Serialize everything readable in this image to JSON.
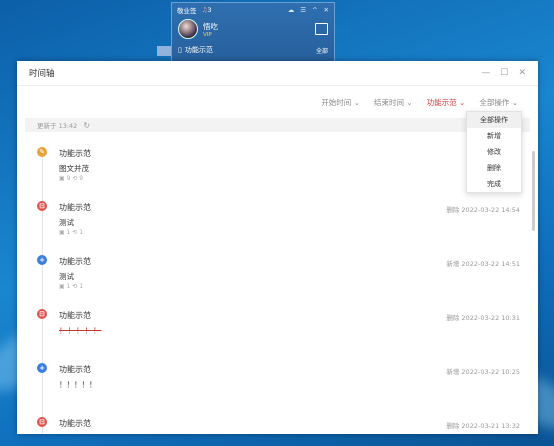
{
  "widget": {
    "name": "敬业签",
    "badge": "3",
    "user": "悟吃",
    "vip": "VIP",
    "category": "功能示范",
    "all": "全部"
  },
  "window": {
    "title": "时间轴",
    "filters": [
      "开始时间",
      "结束时间",
      "功能示范",
      "全部操作"
    ],
    "refresh_text": "更新于 13:42",
    "menu": [
      "全部操作",
      "新增",
      "修改",
      "删除",
      "完成"
    ],
    "entries": [
      {
        "type": "edit",
        "title": "功能示范",
        "time": "修改",
        "text": "图文并茂",
        "meta": "9 ⟲ 9"
      },
      {
        "type": "del",
        "title": "功能示范",
        "time": "删除 2022-03-22 14:54",
        "text": "测试",
        "meta": "1 ⟲ 1"
      },
      {
        "type": "add",
        "title": "功能示范",
        "time": "新增 2022-03-22 14:51",
        "text": "测试",
        "meta": "1 ⟲ 1"
      },
      {
        "type": "del",
        "title": "功能示范",
        "time": "删除 2022-03-22 10:31",
        "text": "！！！！！",
        "meta": ""
      },
      {
        "type": "add",
        "title": "功能示范",
        "time": "新增 2022-03-22 10:25",
        "text": "！！！！！",
        "meta": ""
      },
      {
        "type": "del",
        "title": "功能示范",
        "time": "删除 2022-03-21 13:32",
        "text": "",
        "meta": ""
      }
    ]
  }
}
